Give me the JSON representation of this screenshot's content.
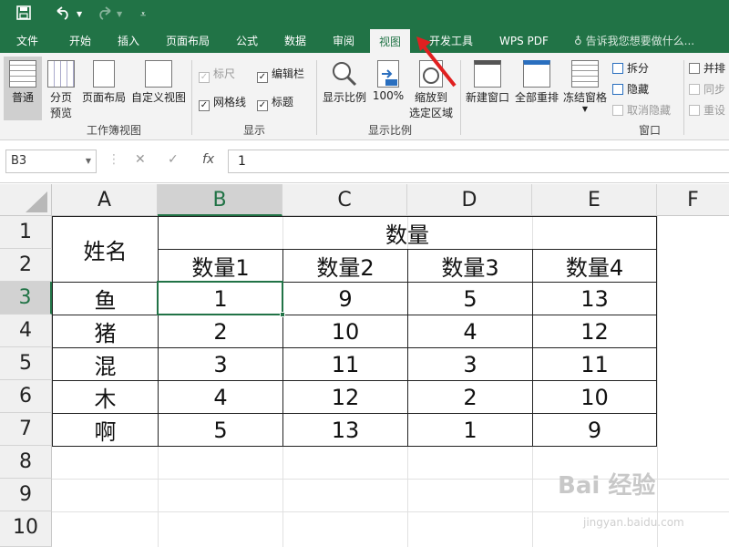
{
  "titlebar": {
    "save_icon": "save-icon",
    "undo_icon": "undo-icon",
    "redo_icon": "redo-icon",
    "customize_icon": "customize-qat-icon"
  },
  "menu": {
    "tabs": [
      "文件",
      "开始",
      "插入",
      "页面布局",
      "公式",
      "数据",
      "审阅",
      "视图",
      "开发工具",
      "WPS PDF"
    ],
    "active_tab": "视图",
    "tell_me": "告诉我您想要做什么..."
  },
  "ribbon": {
    "workbook_views": {
      "normal": "普通",
      "page_break_preview": [
        "分页",
        "预览"
      ],
      "page_layout": "页面布局",
      "custom_views": "自定义视图",
      "group_label": "工作簿视图"
    },
    "show": {
      "ruler": "标尺",
      "formula_bar": "编辑栏",
      "gridlines": "网格线",
      "headings": "标题",
      "group_label": "显示"
    },
    "zoom": {
      "zoom": "显示比例",
      "hundred": "100%",
      "zoom_to_selection": [
        "缩放到",
        "选定区域"
      ],
      "group_label": "显示比例"
    },
    "window": {
      "new_window": "新建窗口",
      "arrange_all": "全部重排",
      "freeze_panes": "冻结窗格",
      "split": "拆分",
      "hide": "隐藏",
      "unhide": "取消隐藏",
      "side_by_side": "并排",
      "sync_scroll": "同步",
      "reset_position": "重设",
      "group_label": "窗口"
    }
  },
  "formula_bar": {
    "name_box": "B3",
    "value": "1",
    "fx": "fx"
  },
  "sheet": {
    "columns": [
      "A",
      "B",
      "C",
      "D",
      "E",
      "F"
    ],
    "rows": [
      "1",
      "2",
      "3",
      "4",
      "5",
      "6",
      "7",
      "8",
      "9",
      "10"
    ],
    "selected_cell": "B3",
    "header_name": "姓名",
    "header_qty": "数量",
    "sub_headers": [
      "数量1",
      "数量2",
      "数量3",
      "数量4"
    ],
    "data": [
      {
        "name": "鱼",
        "values": [
          "1",
          "9",
          "5",
          "13"
        ]
      },
      {
        "name": "猪",
        "values": [
          "2",
          "10",
          "4",
          "12"
        ]
      },
      {
        "name": "混",
        "values": [
          "3",
          "11",
          "3",
          "11"
        ]
      },
      {
        "name": "木",
        "values": [
          "4",
          "12",
          "2",
          "10"
        ]
      },
      {
        "name": "啊",
        "values": [
          "5",
          "13",
          "1",
          "9"
        ]
      }
    ]
  },
  "watermark": {
    "main": "Bai 经验",
    "sub": "jingyan.baidu.com"
  },
  "colors": {
    "excel_green": "#217346",
    "arrow_red": "#e02020"
  }
}
